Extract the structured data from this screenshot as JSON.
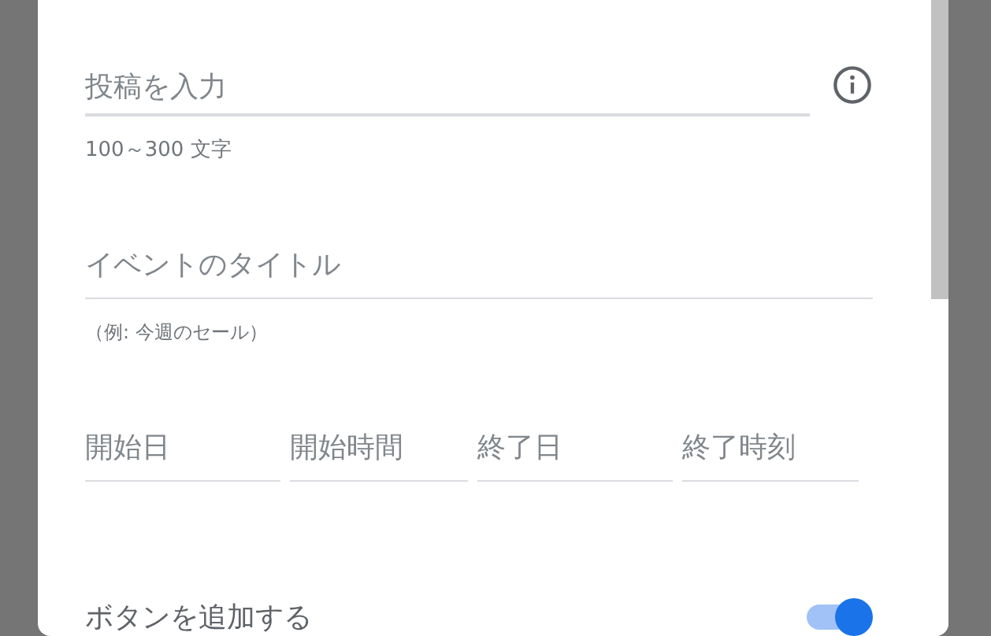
{
  "post_field": {
    "placeholder": "投稿を入力",
    "hint": "100～300 文字"
  },
  "title_field": {
    "placeholder": "イベントのタイトル",
    "hint": "（例: 今週のセール）"
  },
  "date_fields": [
    {
      "placeholder": "開始日"
    },
    {
      "placeholder": "開始時間"
    },
    {
      "placeholder": "終了日"
    },
    {
      "placeholder": "終了時刻"
    }
  ],
  "button_toggle": {
    "label": "ボタンを追加する",
    "on": true
  }
}
